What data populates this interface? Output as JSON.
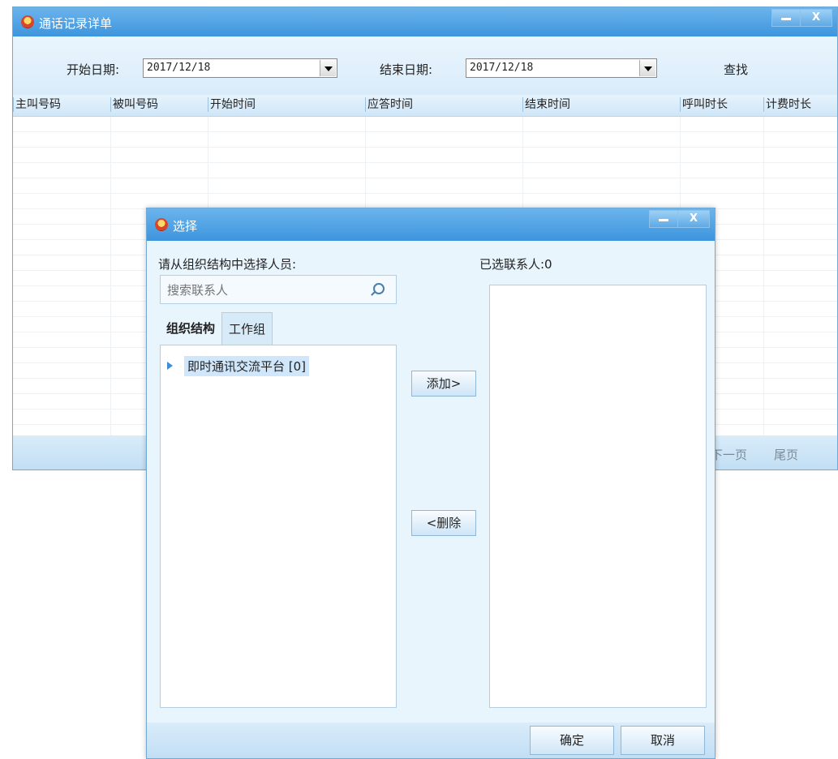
{
  "main_window": {
    "title": "通话记录详单",
    "filter": {
      "start_label": "开始日期:",
      "start_value": "2017/12/18",
      "end_label": "结束日期:",
      "end_value": "2017/12/18",
      "search_label": "查找"
    },
    "columns": [
      "主叫号码",
      "被叫号码",
      "开始时间",
      "应答时间",
      "结束时间",
      "呼叫时长",
      "计费时长"
    ],
    "rows": [],
    "pager": {
      "next": "下一页",
      "last": "尾页"
    }
  },
  "dialog": {
    "title": "选择",
    "instruction": "请从组织结构中选择人员:",
    "selected_label": "已选联系人:0",
    "search_placeholder": "搜索联系人",
    "tabs": [
      "组织结构",
      "工作组"
    ],
    "tree": [
      {
        "label": "即时通讯交流平台 [0]"
      }
    ],
    "add_button": "添加>",
    "remove_button": "<删除",
    "ok_button": "确定",
    "cancel_button": "取消"
  },
  "colors": {
    "titlebar": "#4aa0e2",
    "panel_bg": "#e9f5fd",
    "selection": "#cfe6fb"
  }
}
